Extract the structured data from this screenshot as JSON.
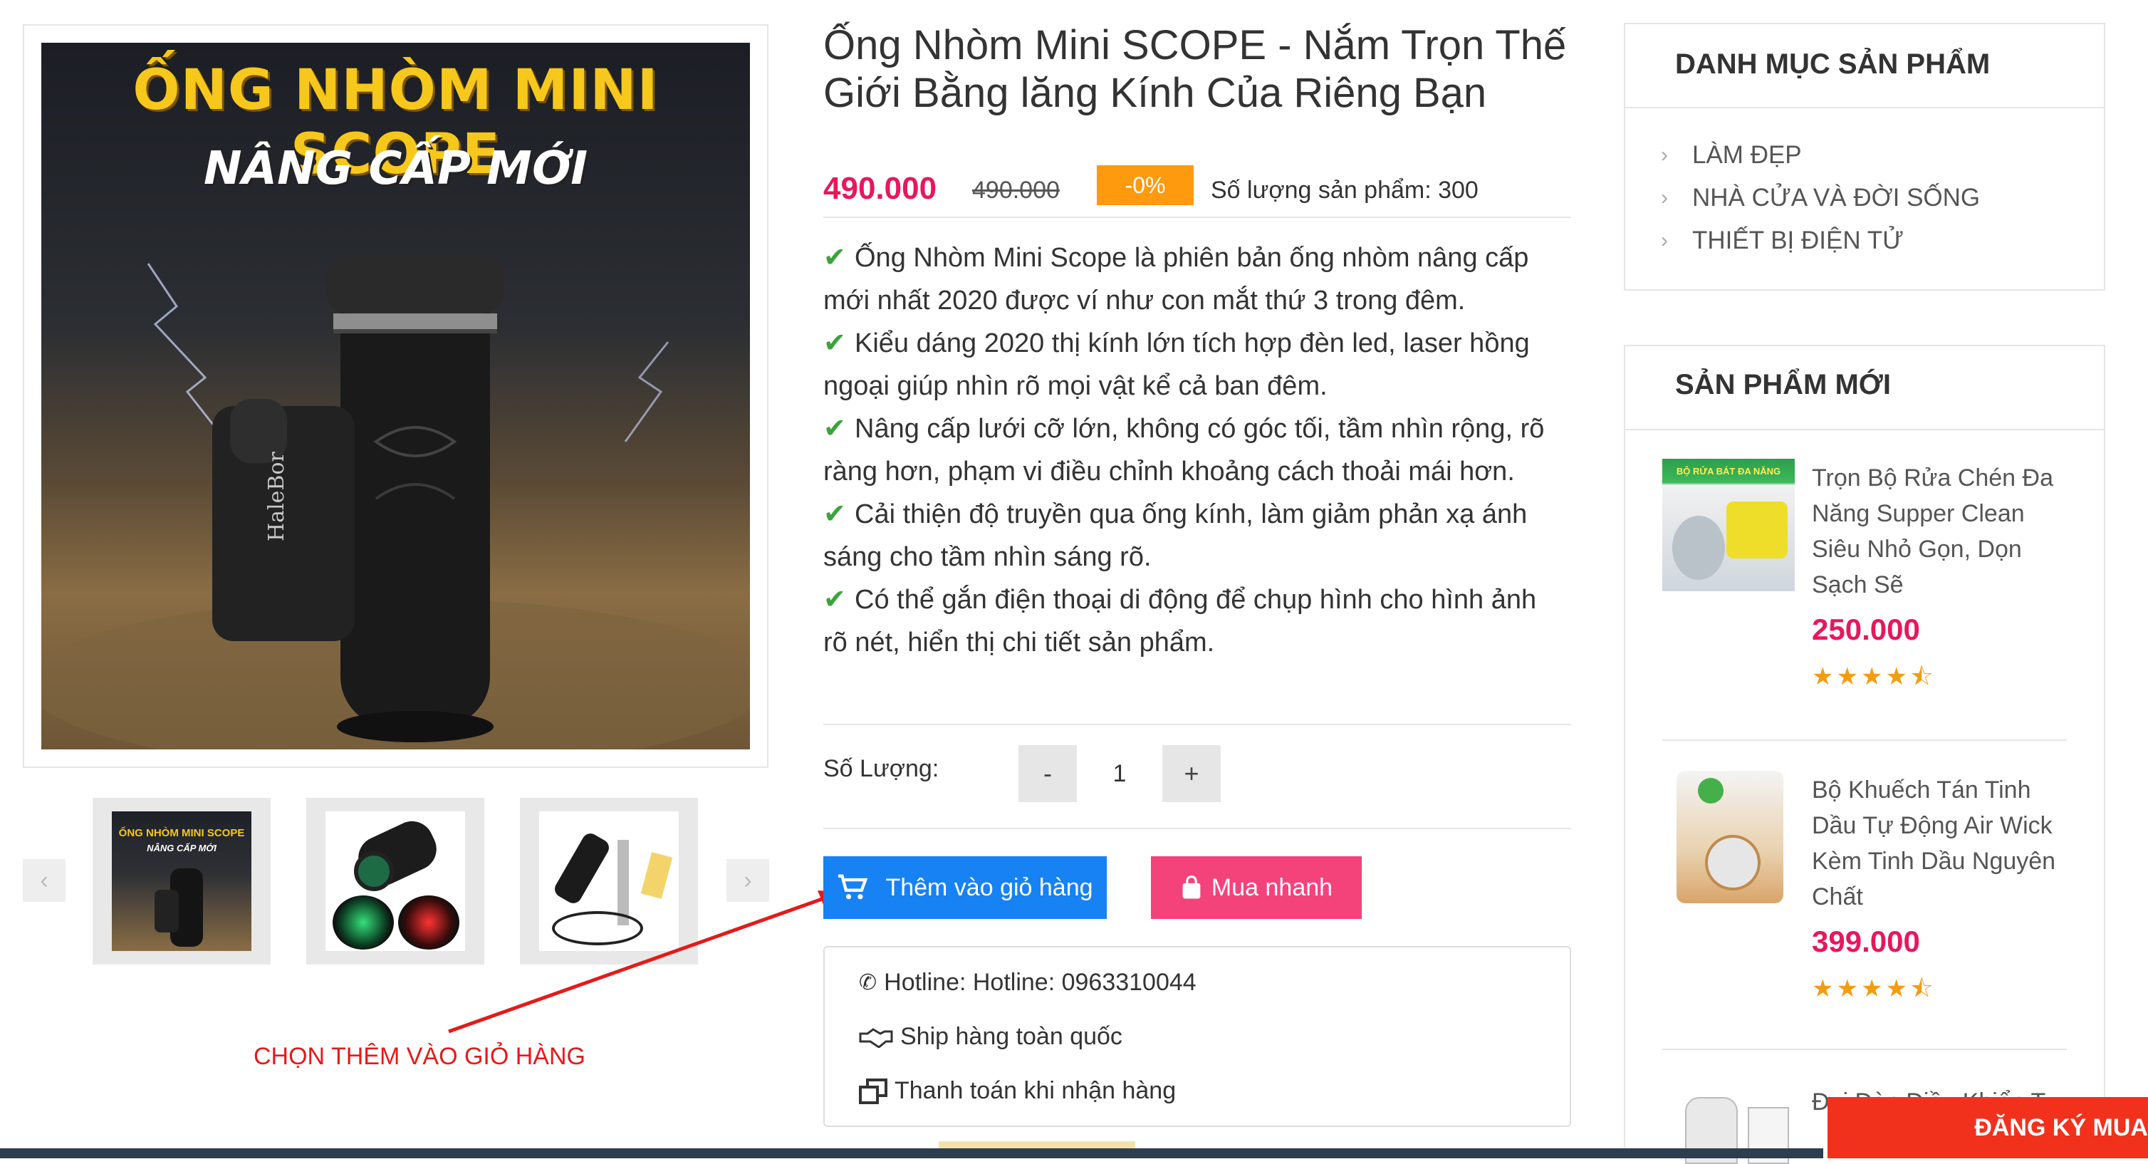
{
  "product": {
    "main_image_line1": "ỐNG NHÒM MINI SCOPE",
    "main_image_line2": "NÂNG CẤP MỚI",
    "device_brand": "HaleBor",
    "thumb1_line1": "ỐNG NHÒM MINI SCOPE",
    "thumb1_line2": "NÂNG CẤP MỚI",
    "title": "Ống Nhòm Mini SCOPE - Nắm Trọn Thế Giới Bằng lăng Kính Của Riêng Bạn",
    "price_new": "490.000",
    "price_old": "490.000",
    "discount": "-0%",
    "stock": "Số lượng sản phẩm: 300",
    "features": [
      "Ống Nhòm Mini Scope là phiên bản ống nhòm nâng cấp mới nhất 2020 được ví như con mắt thứ 3 trong đêm.",
      "Kiểu dáng 2020 thị kính lớn tích hợp đèn led, laser hồng ngoại giúp nhìn rõ mọi vật kể cả ban đêm.",
      "Nâng cấp lưới cỡ lớn, không có góc tối, tầm nhìn rộng, rõ ràng hơn, phạm vi điều chỉnh khoảng cách thoải mái hơn.",
      "Cải thiện độ truyền qua ống kính, làm giảm phản xạ ánh sáng cho tầm nhìn sáng rõ.",
      "Có thể gắn điện thoại di động để chụp hình cho hình ảnh rõ nét, hiển thị chi tiết sản phẩm."
    ],
    "quantity_label": "Số Lượng:",
    "quantity_value": "1",
    "minus": "-",
    "plus": "+",
    "add_to_cart": "Thêm vào giỏ hàng",
    "buy_now": "Mua nhanh",
    "hotline": "Hotline: Hotline: 0963310044",
    "shipping": "Ship hàng toàn quốc",
    "payment": "Thanh toán khi nhận hàng"
  },
  "annotation": {
    "label": "CHỌN THÊM VÀO GIỎ HÀNG",
    "color": "#e31b1b"
  },
  "sidebar": {
    "categories_title": "DANH MỤC SẢN PHẨM",
    "categories": [
      "LÀM ĐẸP",
      "NHÀ CỬA VÀ ĐỜI SỐNG",
      "THIẾT BỊ ĐIỆN TỬ"
    ],
    "new_title": "SẢN PHẨM MỚI",
    "new_products": [
      {
        "name": "Trọn Bộ Rửa Chén Đa Năng Supper Clean Siêu Nhỏ Gọn, Dọn Sạch Sẽ",
        "price": "250.000",
        "thumb_caption": "BỘ RỬA BÁT ĐA NĂNG",
        "rating": 4.5
      },
      {
        "name": "Bộ Khuếch Tán Tinh Dầu Tự Động Air Wick Kèm Tinh Dầu Nguyên Chất",
        "price": "399.000",
        "rating": 4.5
      },
      {
        "name": "Đui Đèn Điều Khiển T",
        "price": ""
      }
    ]
  },
  "cta": {
    "register": "ĐĂNG KÝ MUA"
  },
  "colors": {
    "price": "#e8175d",
    "cart_button": "#1682f3",
    "buy_button": "#f4437a",
    "discount": "#fe9a0d",
    "check": "#3aa43a",
    "register": "#f2311d"
  },
  "icons": [
    "chevron-left-icon",
    "chevron-right-icon",
    "cart-icon",
    "bag-icon",
    "phone-icon",
    "handshake-icon",
    "payment-icon",
    "check-icon",
    "star-icon"
  ]
}
